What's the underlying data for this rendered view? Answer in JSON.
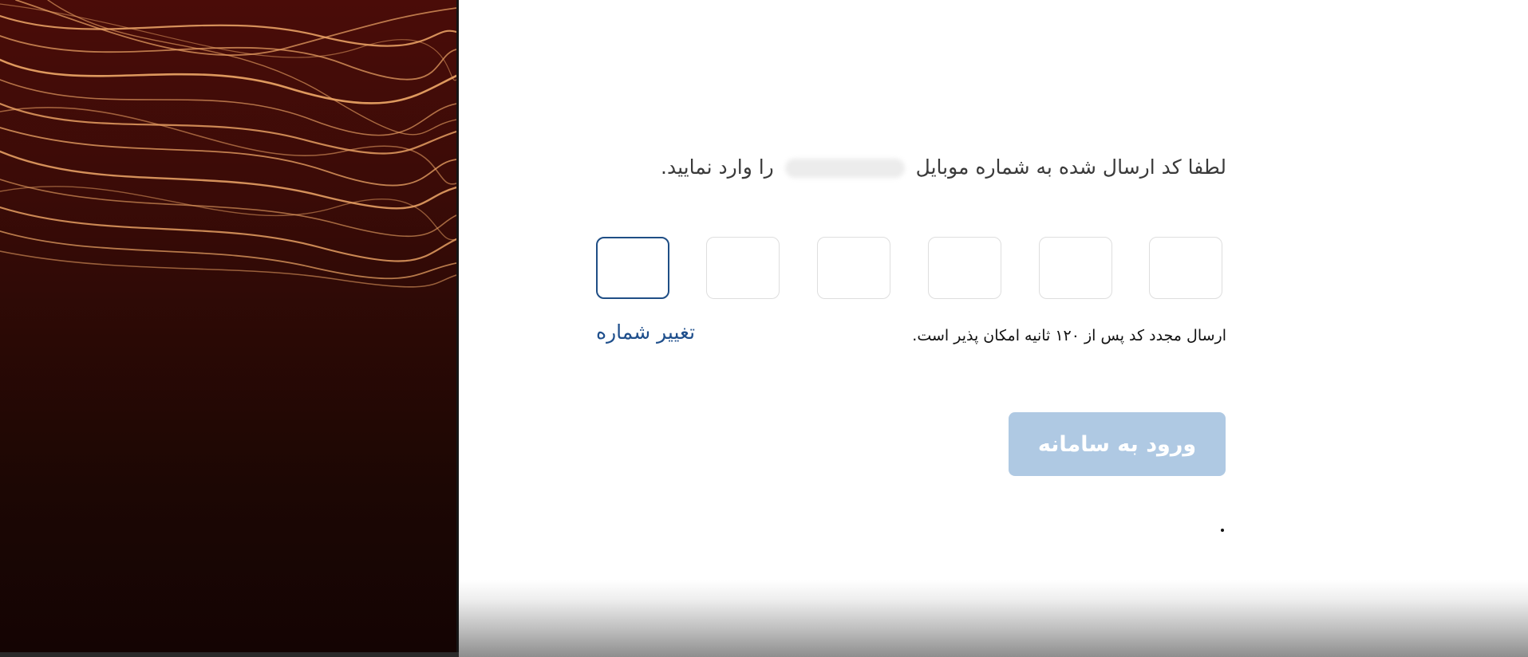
{
  "instruction": {
    "before_phone": "لطفا کد ارسال شده به شماره موبایل",
    "phone_masked": "",
    "after_phone": "را وارد نمایید."
  },
  "otp": {
    "digits": [
      "",
      "",
      "",
      "",
      "",
      ""
    ],
    "active_index": 5
  },
  "resend_text": "ارسال مجدد کد پس از ۱۲۰ ثانیه امکان پذیر است.",
  "change_number_label": "تغییر شماره",
  "login_button_label": "ورود به سامانه",
  "colors": {
    "accent": "#1f4f8c",
    "button_disabled": "#afc9e3",
    "otp_border": "#dedede",
    "otp_active_border": "#1f4e85",
    "panel_bg": "#3a0b07",
    "light_streaks": "#f0a868"
  }
}
